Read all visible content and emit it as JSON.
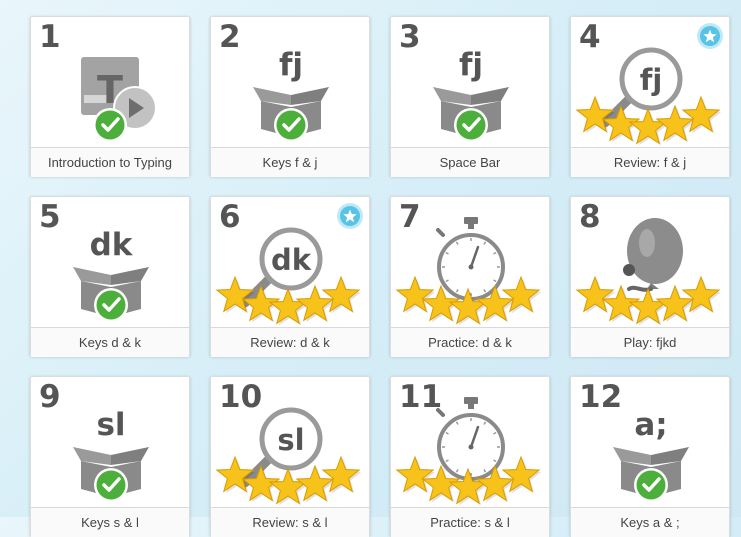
{
  "lessons": [
    {
      "number": "1",
      "title": "Introduction to Typing",
      "glyph": "T",
      "icon": "typing-intro-video-icon",
      "status": "complete",
      "badge": false
    },
    {
      "number": "2",
      "title": "Keys f & j",
      "glyph": "fj",
      "icon": "new-keys-box-icon",
      "status": "complete",
      "badge": false
    },
    {
      "number": "3",
      "title": "Space Bar",
      "glyph": "fj",
      "icon": "new-keys-box-icon",
      "status": "complete",
      "badge": false
    },
    {
      "number": "4",
      "title": "Review: f & j",
      "glyph": "fj",
      "icon": "review-magnifier-icon",
      "status": "5-stars",
      "badge": true
    },
    {
      "number": "5",
      "title": "Keys d & k",
      "glyph": "dk",
      "icon": "new-keys-box-icon",
      "status": "complete",
      "badge": false
    },
    {
      "number": "6",
      "title": "Review: d & k",
      "glyph": "dk",
      "icon": "review-magnifier-icon",
      "status": "5-stars",
      "badge": true
    },
    {
      "number": "7",
      "title": "Practice: d & k",
      "glyph": "",
      "icon": "stopwatch-icon",
      "status": "5-stars",
      "badge": false
    },
    {
      "number": "8",
      "title": "Play: fjkd",
      "glyph": "",
      "icon": "balloon-game-icon",
      "status": "5-stars",
      "badge": false
    },
    {
      "number": "9",
      "title": "Keys s & l",
      "glyph": "sl",
      "icon": "new-keys-box-icon",
      "status": "complete",
      "badge": false
    },
    {
      "number": "10",
      "title": "Review: s & l",
      "glyph": "sl",
      "icon": "review-magnifier-icon",
      "status": "5-stars",
      "badge": false
    },
    {
      "number": "11",
      "title": "Practice: s & l",
      "glyph": "",
      "icon": "stopwatch-icon",
      "status": "5-stars",
      "badge": false
    },
    {
      "number": "12",
      "title": "Keys a & ;",
      "glyph": "a;",
      "icon": "new-keys-box-icon",
      "status": "complete",
      "badge": false
    }
  ],
  "colors": {
    "check_green": "#4caf3c",
    "box_gray": "#8a8a8a",
    "star_gold": "#f7c21a",
    "badge_blue": "#58c3e6",
    "number_gray": "#555555"
  }
}
